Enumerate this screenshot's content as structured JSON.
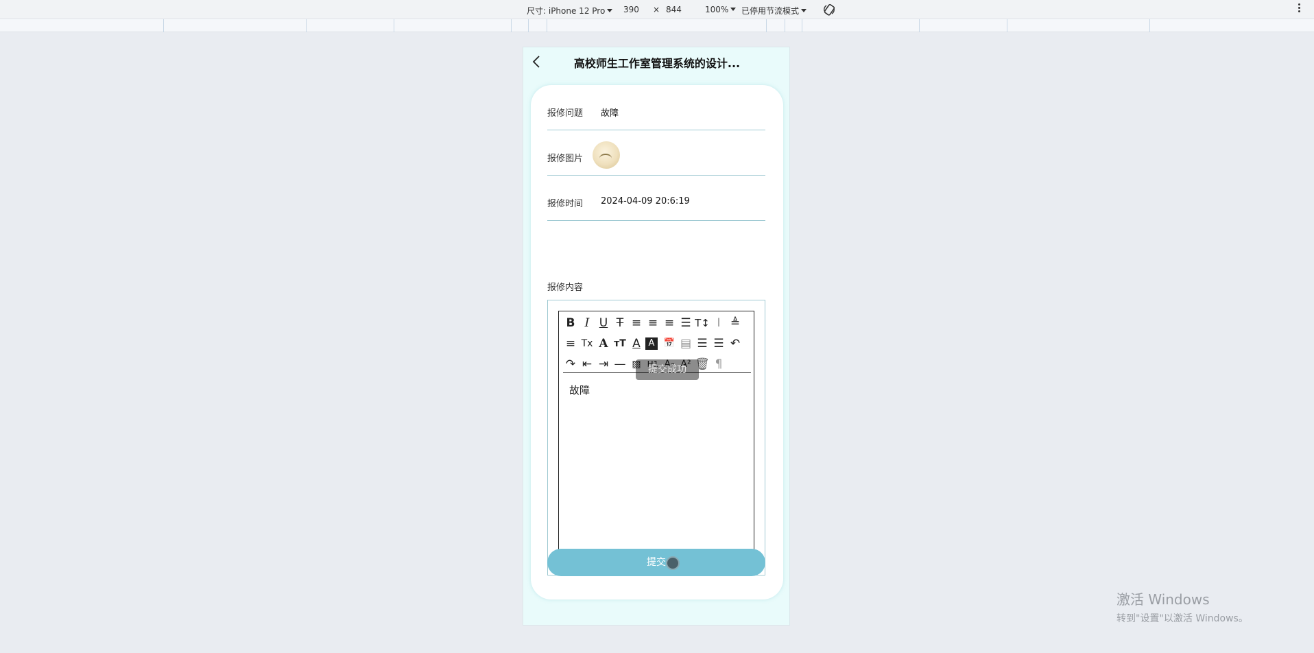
{
  "devtools": {
    "device_label": "尺寸: iPhone 12 Pro",
    "width": "390",
    "times": "×",
    "height": "844",
    "zoom": "100%",
    "throttle": "已停用节流模式",
    "rotate_icon": "rotate-icon",
    "more_icon": "more-vertical-icon"
  },
  "header": {
    "back_icon": "chevron-left-icon",
    "title": "高校师生工作室管理系统的设计..."
  },
  "form": {
    "problem_label": "报修问题",
    "problem_value": "故障",
    "image_label": "报修图片",
    "time_label": "报修时间",
    "time_value": "2024-04-09 20:6:19",
    "content_label": "报修内容"
  },
  "editor": {
    "toolbar": [
      "bold",
      "italic",
      "underline",
      "strikethrough",
      "align-left",
      "align-center",
      "align-right",
      "align-justify",
      "font-size",
      "line-height",
      "space-before",
      "space-after",
      "clear-format",
      "font-color",
      "font-size-adjust",
      "text-color",
      "background-color",
      "date",
      "list-ordered-alt",
      "list-ordered",
      "list-bullet",
      "undo",
      "redo",
      "outdent",
      "indent",
      "horizontal-rule",
      "image",
      "heading",
      "subscript",
      "superscript",
      "delete",
      "paragraph"
    ],
    "body_text": "故障",
    "toast": "提交成功"
  },
  "submit": {
    "label": "提交"
  },
  "watermark": {
    "line1": "激活 Windows",
    "line2": "转到\"设置\"以激活 Windows。"
  },
  "colors": {
    "accent": "#74c1d5",
    "page_bg": "#e9fbfb",
    "field_border": "#9ec9d2"
  }
}
